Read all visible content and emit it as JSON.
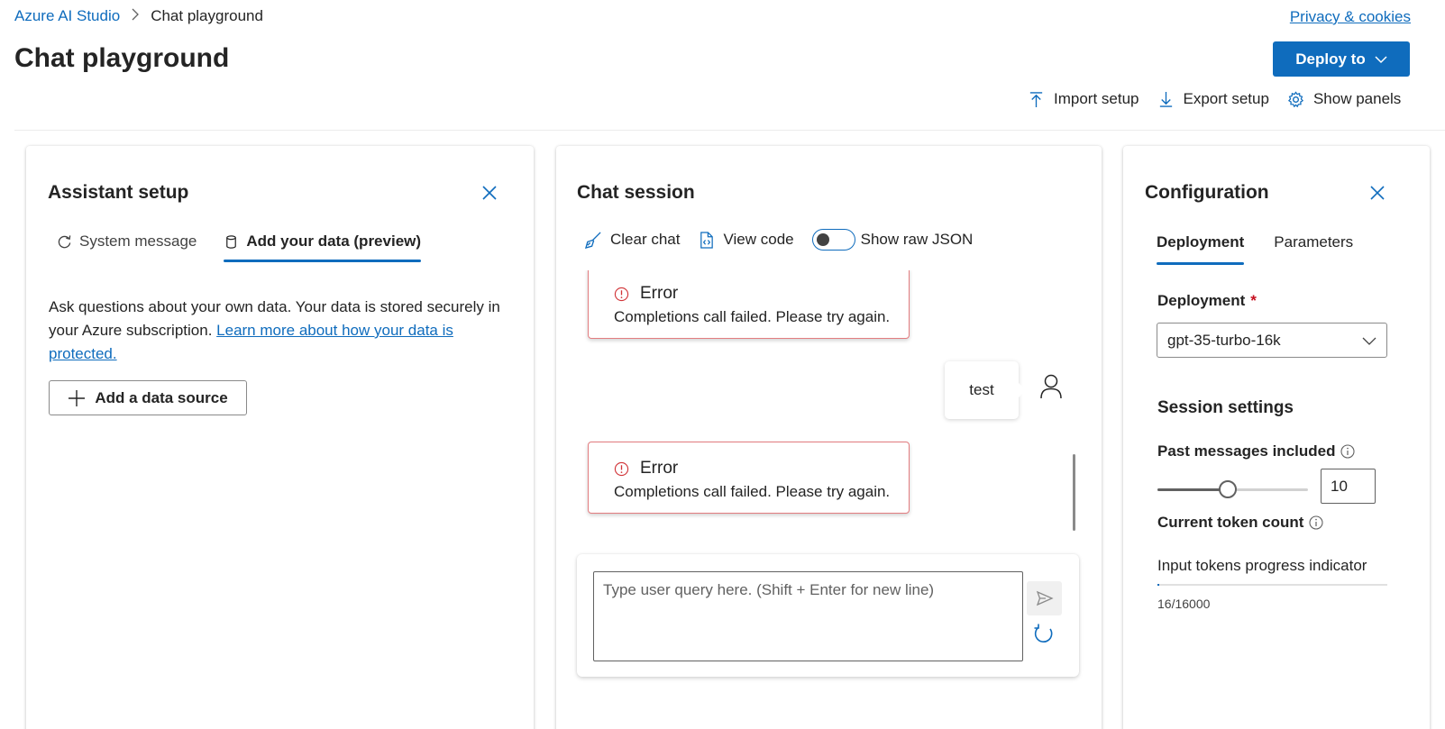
{
  "header": {
    "breadcrumb": [
      "Azure AI Studio",
      "Chat playground"
    ],
    "privacy_link": "Privacy & cookies",
    "title": "Chat playground",
    "deploy_label": "Deploy to",
    "toolbar": {
      "import_label": "Import setup",
      "export_label": "Export setup",
      "panels_label": "Show panels"
    }
  },
  "assistant_setup": {
    "title": "Assistant setup",
    "tabs": [
      {
        "label": "System message",
        "icon": "refresh-icon",
        "active": false
      },
      {
        "label": "Add your data (preview)",
        "icon": "database-icon",
        "active": true
      }
    ],
    "description": "Ask questions about your own data. Your data is stored securely in your Azure subscription. ",
    "learn_link": "Learn more about how your data is protected.",
    "add_source_label": "Add a data source"
  },
  "chat_session": {
    "title": "Chat session",
    "clear_label": "Clear chat",
    "view_code_label": "View code",
    "raw_json_label": "Show raw JSON",
    "raw_json_on": false,
    "messages": [
      {
        "role": "assistant",
        "type": "error",
        "title": "Error",
        "text": "Completions call failed. Please try again."
      },
      {
        "role": "user",
        "text": "test"
      },
      {
        "role": "assistant",
        "type": "error",
        "title": "Error",
        "text": "Completions call failed. Please try again."
      }
    ],
    "input_placeholder": "Type user query here. (Shift + Enter for new line)"
  },
  "configuration": {
    "title": "Configuration",
    "tabs": [
      {
        "label": "Deployment",
        "active": true
      },
      {
        "label": "Parameters",
        "active": false
      }
    ],
    "deployment_label": "Deployment",
    "required_mark": "*",
    "deployment_value": "gpt-35-turbo-16k",
    "session_title": "Session settings",
    "past_messages_label": "Past messages included",
    "past_messages_value": "10",
    "past_messages_fraction": 0.47,
    "token_count_label": "Current token count",
    "progress_label": "Input tokens progress indicator",
    "progress_text": "16/16000",
    "progress_fraction": 0.001
  },
  "colors": {
    "accent": "#0f6cbd",
    "error_border": "#e37d80",
    "error_icon": "#d13438"
  }
}
